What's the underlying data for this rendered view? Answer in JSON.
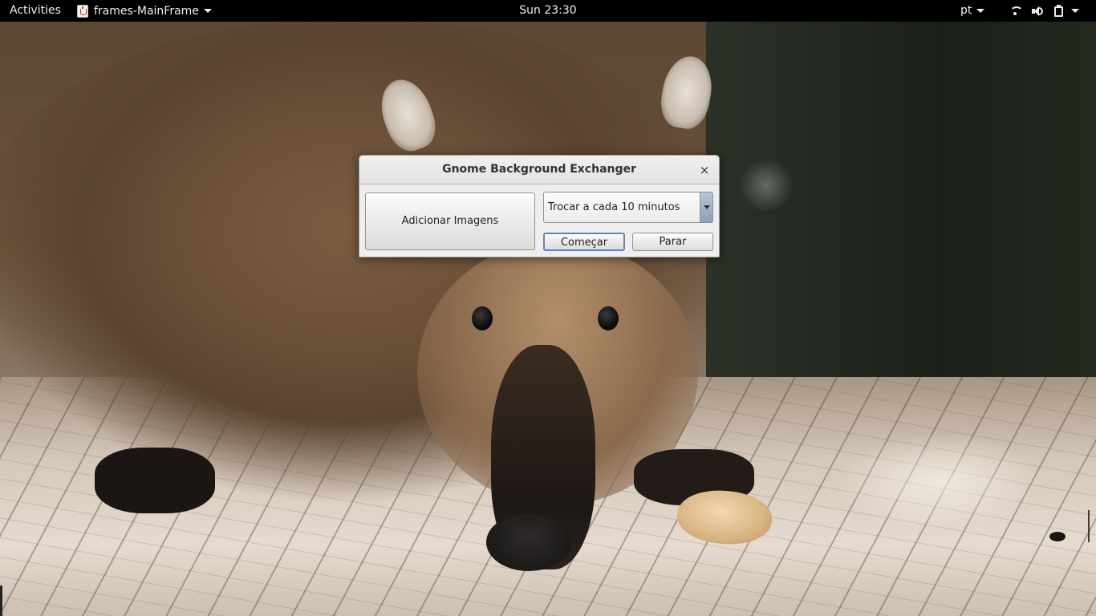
{
  "topbar": {
    "activities": "Activities",
    "app_name": "frames-MainFrame",
    "clock": "Sun 23:30",
    "language": "pt",
    "status_icons": [
      "wifi-icon",
      "volume-icon",
      "battery-icon"
    ]
  },
  "dialog": {
    "title": "Gnome Background Exchanger",
    "close_glyph": "×",
    "add_images_label": "Adicionar Imagens",
    "interval_selected": "Trocar a cada 10 minutos",
    "start_label": "Começar",
    "stop_label": "Parar"
  },
  "colors": {
    "topbar_bg": "#000000",
    "dialog_bg": "#e8e8e7",
    "focus_border": "#5f86b5"
  }
}
